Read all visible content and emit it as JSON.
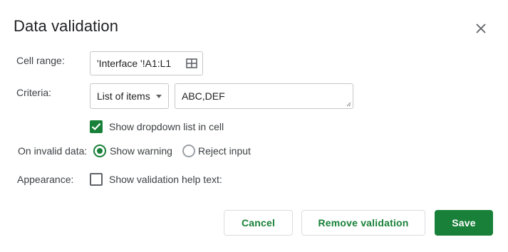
{
  "dialog": {
    "title": "Data validation",
    "close_icon": "close-icon"
  },
  "cell_range": {
    "label": "Cell range:",
    "value": "'Interface '!A1:L1",
    "icon": "grid-select-icon"
  },
  "criteria": {
    "label": "Criteria:",
    "selected": "List of items",
    "items_value": "ABC,DEF"
  },
  "show_dropdown": {
    "label": "Show dropdown list in cell",
    "checked": true
  },
  "invalid_data": {
    "label": "On invalid data:",
    "options": [
      {
        "label": "Show warning",
        "selected": true
      },
      {
        "label": "Reject input",
        "selected": false
      }
    ]
  },
  "appearance": {
    "label": "Appearance:",
    "help_text_label": "Show validation help text:",
    "checked": false
  },
  "buttons": {
    "cancel": "Cancel",
    "remove": "Remove validation",
    "save": "Save"
  },
  "colors": {
    "accent": "#188038",
    "text": "#202124",
    "border": "#c6c6c6"
  }
}
